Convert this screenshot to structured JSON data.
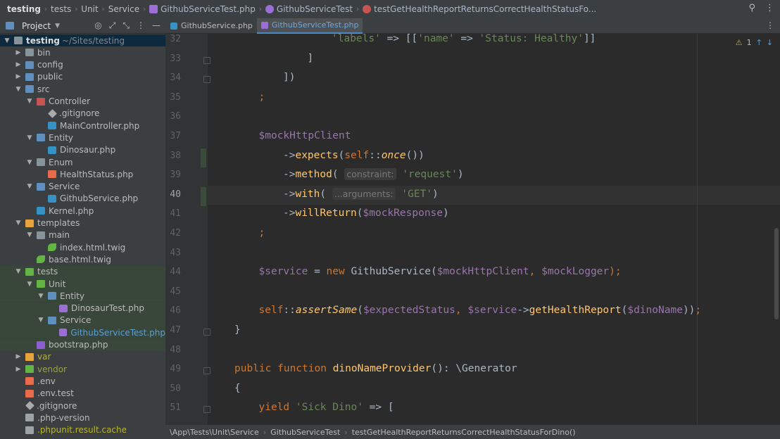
{
  "breadcrumbs": [
    "testing",
    "tests",
    "Unit",
    "Service",
    "GithubServiceTest.php",
    "GithubServiceTest",
    "testGetHealthReportReturnsCorrectHealthStatusFo..."
  ],
  "toolbar": {
    "project_label": "Project"
  },
  "tabs": [
    {
      "label": "GithubService.php",
      "active": false
    },
    {
      "label": "GithubServiceTest.php",
      "active": true
    }
  ],
  "tree": [
    {
      "label": "testing",
      "extra": "~/Sites/testing",
      "depth": 0,
      "chev": "down",
      "icon": "folder",
      "bold": true,
      "state": "sel"
    },
    {
      "label": "bin",
      "depth": 1,
      "chev": "right",
      "icon": "folder"
    },
    {
      "label": "config",
      "depth": 1,
      "chev": "right",
      "icon": "folder blue"
    },
    {
      "label": "public",
      "depth": 1,
      "chev": "right",
      "icon": "folder blue"
    },
    {
      "label": "src",
      "depth": 1,
      "chev": "down",
      "icon": "folder blue"
    },
    {
      "label": "Controller",
      "depth": 2,
      "chev": "down",
      "icon": "folder red"
    },
    {
      "label": ".gitignore",
      "depth": 3,
      "icon": "file-git"
    },
    {
      "label": "MainController.php",
      "depth": 3,
      "icon": "file-php"
    },
    {
      "label": "Entity",
      "depth": 2,
      "chev": "down",
      "icon": "folder blue"
    },
    {
      "label": "Dinosaur.php",
      "depth": 3,
      "icon": "file-php"
    },
    {
      "label": "Enum",
      "depth": 2,
      "chev": "down",
      "icon": "folder"
    },
    {
      "label": "HealthStatus.php",
      "depth": 3,
      "icon": "file-enum"
    },
    {
      "label": "Service",
      "depth": 2,
      "chev": "down",
      "icon": "folder blue"
    },
    {
      "label": "GithubService.php",
      "depth": 3,
      "icon": "file-php"
    },
    {
      "label": "Kernel.php",
      "depth": 2,
      "icon": "file-php"
    },
    {
      "label": "templates",
      "depth": 1,
      "chev": "down",
      "icon": "folder orange"
    },
    {
      "label": "main",
      "depth": 2,
      "chev": "down",
      "icon": "folder"
    },
    {
      "label": "index.html.twig",
      "depth": 3,
      "icon": "file-twig"
    },
    {
      "label": "base.html.twig",
      "depth": 2,
      "icon": "file-twig"
    },
    {
      "label": "tests",
      "depth": 1,
      "chev": "down",
      "icon": "folder green",
      "state": "hl"
    },
    {
      "label": "Unit",
      "depth": 2,
      "chev": "down",
      "icon": "folder green",
      "state": "hl"
    },
    {
      "label": "Entity",
      "depth": 3,
      "chev": "down",
      "icon": "folder blue",
      "state": "hl"
    },
    {
      "label": "DinosaurTest.php",
      "depth": 4,
      "icon": "file-test",
      "state": "hl"
    },
    {
      "label": "Service",
      "depth": 3,
      "chev": "down",
      "icon": "folder blue",
      "state": "hl"
    },
    {
      "label": "GithubServiceTest.php",
      "depth": 4,
      "icon": "file-test",
      "state": "hl",
      "color": "blue"
    },
    {
      "label": "bootstrap.php",
      "depth": 2,
      "icon": "file-boot",
      "state": "hl"
    },
    {
      "label": "var",
      "depth": 1,
      "chev": "right",
      "icon": "folder orange",
      "color": "yellow"
    },
    {
      "label": "vendor",
      "depth": 1,
      "chev": "right",
      "icon": "folder green",
      "color": "olive"
    },
    {
      "label": ".env",
      "depth": 1,
      "icon": "file-enum"
    },
    {
      "label": ".env.test",
      "depth": 1,
      "icon": "file-enum"
    },
    {
      "label": ".gitignore",
      "depth": 1,
      "icon": "file-git"
    },
    {
      "label": ".php-version",
      "depth": 1,
      "icon": "file-txt"
    },
    {
      "label": ".phpunit.result.cache",
      "depth": 1,
      "icon": "file-txt",
      "color": "yellow"
    }
  ],
  "editor": {
    "current_line": 40,
    "inspection_count": "1",
    "lines": [
      {
        "n": 32,
        "indent": 4,
        "parts": [
          [
            "str",
            "'labels'"
          ],
          [
            "",
            " => [["
          ],
          [
            "str",
            "'name'"
          ],
          [
            "",
            " => "
          ],
          [
            "str",
            "'Status: Healthy'"
          ],
          [
            "",
            "]]"
          ]
        ]
      },
      {
        "n": 33,
        "indent": 3,
        "parts": [
          [
            "",
            "]"
          ]
        ]
      },
      {
        "n": 34,
        "indent": 2,
        "parts": [
          [
            "",
            "])"
          ]
        ]
      },
      {
        "n": 35,
        "indent": 1,
        "parts": [
          [
            "kw",
            ";"
          ]
        ]
      },
      {
        "n": 36,
        "indent": 0,
        "parts": []
      },
      {
        "n": 37,
        "indent": 1,
        "parts": [
          [
            "var",
            "$mockHttpClient"
          ]
        ]
      },
      {
        "n": 38,
        "indent": 2,
        "parts": [
          [
            "",
            "->"
          ],
          [
            "fn",
            "expects"
          ],
          [
            "",
            "("
          ],
          [
            "kw",
            "self"
          ],
          [
            "",
            "::"
          ],
          [
            "fn it",
            "once"
          ],
          [
            "",
            "())"
          ]
        ]
      },
      {
        "n": 39,
        "indent": 2,
        "parts": [
          [
            "",
            "->"
          ],
          [
            "fn",
            "method"
          ],
          [
            "",
            "( "
          ],
          [
            "hint",
            "constraint:"
          ],
          [
            "",
            " "
          ],
          [
            "str",
            "'request'"
          ],
          [
            "",
            ")"
          ]
        ]
      },
      {
        "n": 40,
        "indent": 2,
        "parts": [
          [
            "",
            "->"
          ],
          [
            "fn",
            "with"
          ],
          [
            "",
            "( "
          ],
          [
            "hint",
            "...arguments:"
          ],
          [
            "",
            " "
          ],
          [
            "str",
            "'GET'"
          ],
          [
            "",
            ")"
          ]
        ]
      },
      {
        "n": 41,
        "indent": 2,
        "parts": [
          [
            "",
            "->"
          ],
          [
            "fn",
            "willReturn"
          ],
          [
            "",
            "("
          ],
          [
            "var",
            "$mockResponse"
          ],
          [
            "",
            ")"
          ]
        ]
      },
      {
        "n": 42,
        "indent": 1,
        "parts": [
          [
            "kw",
            ";"
          ]
        ]
      },
      {
        "n": 43,
        "indent": 0,
        "parts": []
      },
      {
        "n": 44,
        "indent": 1,
        "parts": [
          [
            "var",
            "$service"
          ],
          [
            "",
            " = "
          ],
          [
            "kw",
            "new "
          ],
          [
            "",
            "GithubService("
          ],
          [
            "var",
            "$mockHttpClient"
          ],
          [
            "kw",
            ", "
          ],
          [
            "var",
            "$mockLogger"
          ],
          [
            "kw",
            ");"
          ]
        ]
      },
      {
        "n": 45,
        "indent": 0,
        "parts": []
      },
      {
        "n": 46,
        "indent": 1,
        "parts": [
          [
            "kw",
            "self"
          ],
          [
            "",
            "::"
          ],
          [
            "fn it",
            "assertSame"
          ],
          [
            "",
            "("
          ],
          [
            "var",
            "$expectedStatus"
          ],
          [
            "kw",
            ", "
          ],
          [
            "var",
            "$service"
          ],
          [
            "",
            "->"
          ],
          [
            "fn",
            "getHealthReport"
          ],
          [
            "",
            "("
          ],
          [
            "var",
            "$dinoName"
          ],
          [
            "",
            "))"
          ],
          [
            "kw",
            ";"
          ]
        ]
      },
      {
        "n": 47,
        "indent": 0,
        "parts": [
          [
            "",
            "}"
          ]
        ]
      },
      {
        "n": 48,
        "indent": 0,
        "parts": []
      },
      {
        "n": 49,
        "indent": 0,
        "parts": [
          [
            "kw",
            "public function "
          ],
          [
            "fn",
            "dinoNameProvider"
          ],
          [
            "",
            "(): \\Generator"
          ]
        ]
      },
      {
        "n": 50,
        "indent": 0,
        "parts": [
          [
            "",
            "{"
          ]
        ]
      },
      {
        "n": 51,
        "indent": 1,
        "parts": [
          [
            "kw",
            "yield "
          ],
          [
            "str",
            "'Sick Dino'"
          ],
          [
            "",
            " => ["
          ]
        ]
      }
    ]
  },
  "statusbar": {
    "namespace": "\\App\\Tests\\Unit\\Service",
    "class": "GithubServiceTest",
    "method": "testGetHealthReportReturnsCorrectHealthStatusForDino()"
  }
}
